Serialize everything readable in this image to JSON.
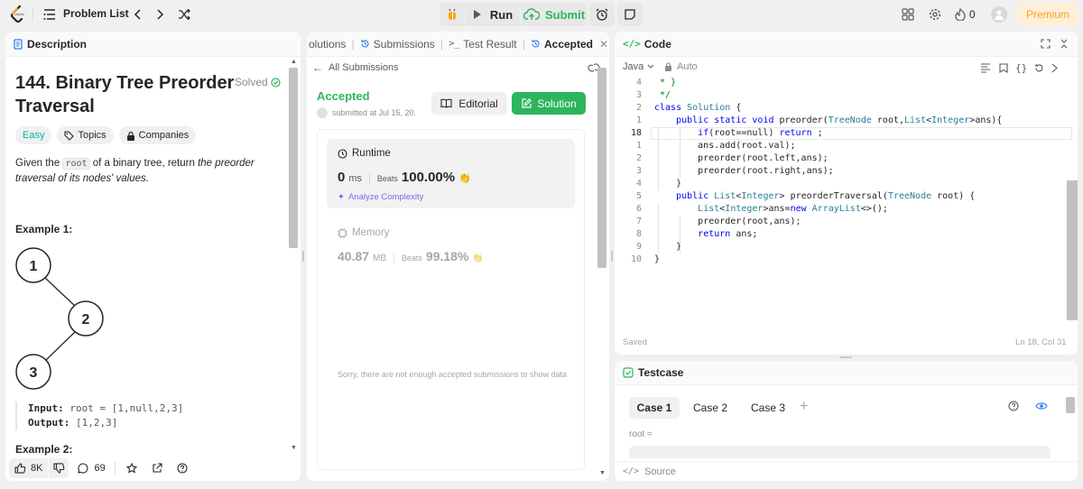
{
  "topbar": {
    "problem_list": "Problem List",
    "run": "Run",
    "submit": "Submit",
    "points": "0",
    "premium": "Premium"
  },
  "description": {
    "tab": "Description",
    "title_line1": "144. Binary Tree Preorder",
    "title_line2": "Traversal",
    "solved": "Solved",
    "chips": [
      "Easy",
      "Topics",
      "Companies"
    ],
    "text_1": "Given the",
    "text_code": "root",
    "text_2": "of a binary tree, return",
    "text_em1": "the preorder",
    "text_em2": "traversal of its nodes' values.",
    "example1": "Example 1:",
    "tree_nodes": [
      "1",
      "2",
      "3"
    ],
    "input_label": "Input:",
    "input_value": "root = [1,null,2,3]",
    "output_label": "Output:",
    "output_value": "[1,2,3]",
    "example2": "Example 2:",
    "likes": "8K",
    "comments": "69"
  },
  "middle": {
    "tabs": [
      "olutions",
      "Submissions",
      "Test Result",
      "Accepted"
    ],
    "back": "All Submissions",
    "status": "Accepted",
    "submitted": "submitted at Jul 15, 20.",
    "editorial": "Editorial",
    "solution": "Solution",
    "runtime_label": "Runtime",
    "runtime_value": "0",
    "runtime_unit": "ms",
    "beats": "Beats",
    "runtime_beats": "100.00%",
    "analyze": "Analyze Complexity",
    "memory_label": "Memory",
    "memory_value": "40.87",
    "memory_unit": "MB",
    "memory_beats": "99.18%",
    "note": "Sorry, there are not enough accepted submissions to show data"
  },
  "code": {
    "tab": "Code",
    "language": "Java",
    "auto": "Auto",
    "lines": [
      {
        "n": "4",
        "t": " * }"
      },
      {
        "n": "3",
        "t": " */"
      },
      {
        "n": "2",
        "t": "class Solution {"
      },
      {
        "n": "1",
        "t": "    public static void preorder(TreeNode root,List<Integer>ans){"
      },
      {
        "n": "18",
        "t": "        if(root==null) return ;"
      },
      {
        "n": "1",
        "t": "        ans.add(root.val);"
      },
      {
        "n": "2",
        "t": "        preorder(root.left,ans);"
      },
      {
        "n": "3",
        "t": "        preorder(root.right,ans);"
      },
      {
        "n": "4",
        "t": "    }"
      },
      {
        "n": "5",
        "t": "    public List<Integer> preorderTraversal(TreeNode root) {"
      },
      {
        "n": "6",
        "t": "        List<Integer>ans=new ArrayList<>();"
      },
      {
        "n": "7",
        "t": "        preorder(root,ans);"
      },
      {
        "n": "8",
        "t": "        return ans;"
      },
      {
        "n": "9",
        "t": "    }"
      },
      {
        "n": "10",
        "t": "}"
      }
    ],
    "saved": "Saved",
    "position": "Ln 18, Col 31"
  },
  "testcase": {
    "tab": "Testcase",
    "cases": [
      "Case 1",
      "Case 2",
      "Case 3"
    ],
    "root_label": "root =",
    "source": "Source"
  },
  "colors": {
    "green": "#2db55d",
    "orange": "#ffa116",
    "blue": "#2f80ed"
  }
}
